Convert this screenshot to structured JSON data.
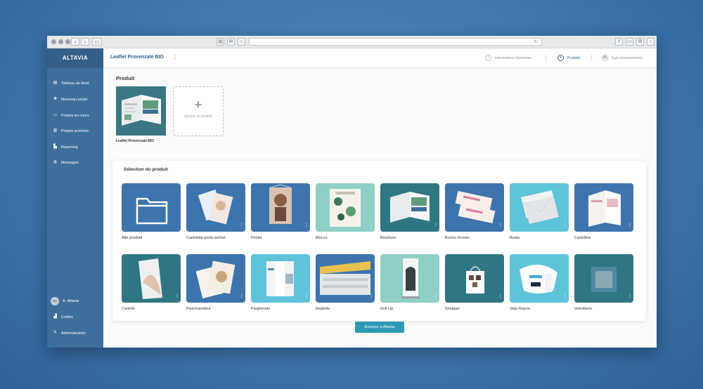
{
  "browser": {
    "back_glyph": "‹",
    "forward_glyph": "›",
    "sidebar_glyph": "▭",
    "reload_glyph": "↻"
  },
  "sidebar": {
    "logo": "ALTAVIA",
    "items": [
      {
        "label": "Tableau de bord",
        "icon": "dashboard-icon",
        "glyph": "▤"
      },
      {
        "label": "Nouveau projet",
        "icon": "plus-icon",
        "glyph": "✚"
      },
      {
        "label": "Projets en cours",
        "icon": "folder-icon",
        "glyph": "▭"
      },
      {
        "label": "Projets archivés",
        "icon": "archive-icon",
        "glyph": "▥"
      },
      {
        "label": "Reporting",
        "icon": "chart-icon",
        "glyph": "▙"
      },
      {
        "label": "Messages",
        "icon": "chat-icon",
        "glyph": "◍"
      }
    ],
    "user": {
      "initials": "AA",
      "name": "A. Altavia"
    },
    "bottom_items": [
      {
        "label": "Entités",
        "icon": "building-icon",
        "glyph": "▟"
      },
      {
        "label": "Administration",
        "icon": "wrench-icon",
        "glyph": "✎"
      }
    ]
  },
  "header": {
    "project_title": "Leaflet Provenzale BIO",
    "menu_glyph": "⋮",
    "nav": [
      {
        "label": "Informations Générales",
        "icon": "info-icon",
        "glyph": "i",
        "active": false
      },
      {
        "label": "Produits",
        "icon": "cart-icon",
        "glyph": "▾",
        "active": true
      },
      {
        "label": "Suivi d'avancement",
        "icon": "calendar-icon",
        "glyph": "▦",
        "active": false
      }
    ]
  },
  "produit": {
    "title": "Produit",
    "selected_name": "Leaflet Provenzale BIO",
    "add_plus": "+",
    "add_label": "Ajouter un produit"
  },
  "selection": {
    "title": "Sélection du produit",
    "adjust_glyph": "⫶⫶",
    "products": [
      {
        "name": "Altri prodotti",
        "bg": "#3d74ae",
        "art": "folder"
      },
      {
        "name": "Carteletta porta sachet",
        "bg": "#3d74ae",
        "art": "card"
      },
      {
        "name": "Poster",
        "bg": "#3d74ae",
        "art": "poster"
      },
      {
        "name": "Blocco",
        "bg": "#8fcfc6",
        "art": "block"
      },
      {
        "name": "Brochure",
        "bg": "#2f7685",
        "art": "brochure"
      },
      {
        "name": "Buono Sconto",
        "bg": "#3d74ae",
        "art": "coupon"
      },
      {
        "name": "Busta",
        "bg": "#5ec4d9",
        "art": "envelope"
      },
      {
        "name": "Cartellina",
        "bg": "#3d74ae",
        "art": "folderbook"
      },
      {
        "name": "Cartello",
        "bg": "#2f7685",
        "art": "sign"
      },
      {
        "name": "Flyer/cartolina",
        "bg": "#3d74ae",
        "art": "flyer"
      },
      {
        "name": "Pieghevole",
        "bg": "#5ec4d9",
        "art": "fold"
      },
      {
        "name": "Reglette",
        "bg": "#3d74ae",
        "art": "shelf"
      },
      {
        "name": "Roll Up",
        "bg": "#8fcfc6",
        "art": "rollup"
      },
      {
        "name": "Shopper",
        "bg": "#2f7685",
        "art": "bag"
      },
      {
        "name": "Stop Rayon",
        "bg": "#5ec4d9",
        "art": "stopper"
      },
      {
        "name": "Vetrofania",
        "bg": "#2f7685",
        "art": "window"
      }
    ]
  },
  "actions": {
    "send_label": "Envoyer à Altavia"
  }
}
